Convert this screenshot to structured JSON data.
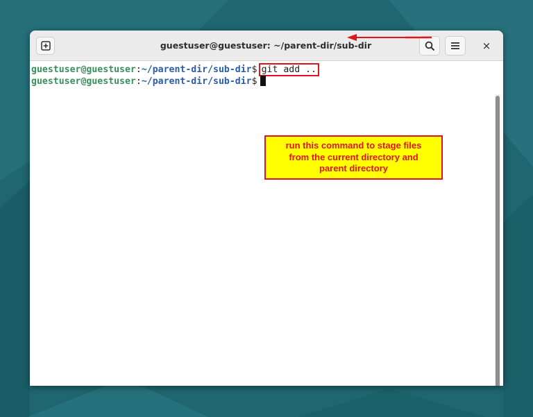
{
  "window": {
    "title": "guestuser@guestuser: ~/parent-dir/sub-dir"
  },
  "icons": {
    "new_tab": "new-tab-icon",
    "search": "search-icon",
    "menu": "hamburger-menu-icon",
    "close": "close-icon"
  },
  "close_glyph": "×",
  "terminal": {
    "lines": [
      {
        "user": "guestuser@guestuser",
        "colon": ":",
        "path": "~/parent-dir/sub-dir",
        "dollar": "$",
        "command": "git add .."
      },
      {
        "user": "guestuser@guestuser",
        "colon": ":",
        "path": "~/parent-dir/sub-dir",
        "dollar": "$",
        "command": ""
      }
    ]
  },
  "annotation": {
    "text_lines": [
      "run this command to stage files",
      "from the current directory and",
      "parent  directory"
    ]
  },
  "colors": {
    "desktop_bg": "#1f6670",
    "prompt_user": "#3a8f5a",
    "prompt_path": "#2a5ca8",
    "annotation_red": "#e0141c",
    "annotation_fill": "#ffff00"
  }
}
